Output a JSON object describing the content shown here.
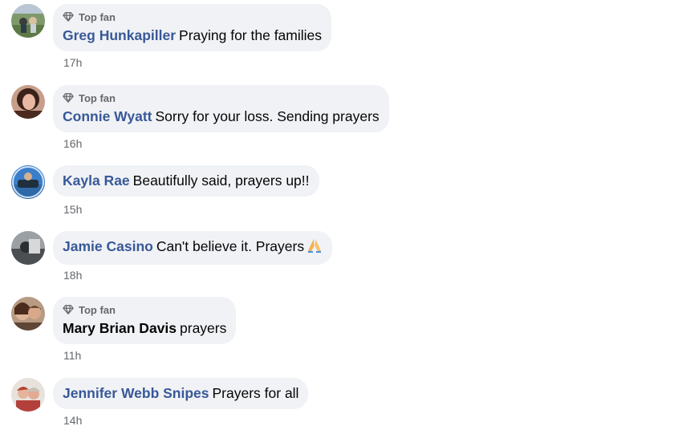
{
  "badge_label": "Top fan",
  "comments": [
    {
      "author": "Greg Hunkapiller",
      "text": "Praying for the families",
      "time": "17h"
    },
    {
      "author": "Connie Wyatt",
      "text": "Sorry for your loss. Sending prayers",
      "time": "16h"
    },
    {
      "author": "Kayla Rae",
      "text": "Beautifully said, prayers up!!",
      "time": "15h"
    },
    {
      "author": "Jamie Casino",
      "text": "Can't believe it. Prayers",
      "emoji": "folded-hands",
      "time": "18h"
    },
    {
      "author": "Mary Brian Davis",
      "text": "prayers",
      "time": "11h"
    },
    {
      "author": "Jennifer Webb Snipes",
      "text": "Prayers for all",
      "time": "14h"
    }
  ],
  "colors": {
    "author_link": "#385898",
    "bubble_bg": "#f0f2f5",
    "secondary_text": "#65676b",
    "primary_text": "#050505"
  },
  "icons": [
    "diamond-icon",
    "folded-hands-emoji",
    "avatar"
  ]
}
